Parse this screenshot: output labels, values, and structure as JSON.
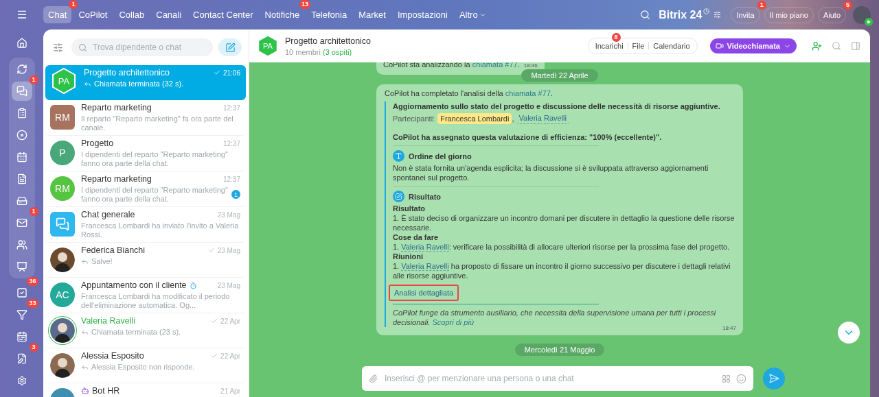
{
  "top_nav": {
    "items": [
      {
        "label": "Chat",
        "selected": true,
        "badge": "1",
        "caret": false
      },
      {
        "label": "CoPilot",
        "selected": false,
        "caret": false
      },
      {
        "label": "Collab",
        "selected": false,
        "caret": false
      },
      {
        "label": "Canali",
        "selected": false,
        "caret": false
      },
      {
        "label": "Contact Center",
        "selected": false,
        "caret": false
      },
      {
        "label": "Notifiche",
        "selected": false,
        "badge": "13",
        "caret": false
      },
      {
        "label": "Telefonia",
        "selected": false,
        "caret": false
      },
      {
        "label": "Market",
        "selected": false,
        "caret": false
      },
      {
        "label": "Impostazioni",
        "selected": false,
        "caret": false
      },
      {
        "label": "Altro",
        "selected": false,
        "caret": true
      }
    ],
    "brand": "Bitrix 24",
    "buttons": [
      {
        "label": "Invita",
        "badge": "1"
      },
      {
        "label": "Il mio piano"
      },
      {
        "label": "Aiuto",
        "badge": "5"
      }
    ]
  },
  "rail": {
    "sections": [
      {
        "framed": false,
        "items": [
          {
            "kind": "home",
            "selected": false
          }
        ]
      },
      {
        "framed": true,
        "items": [
          {
            "kind": "feed",
            "selected": false
          },
          {
            "kind": "chat",
            "selected": true,
            "badge": "1"
          },
          {
            "kind": "list",
            "selected": false
          },
          {
            "kind": "target",
            "selected": false
          },
          {
            "kind": "calendar",
            "selected": false
          },
          {
            "kind": "file",
            "selected": false
          },
          {
            "kind": "drive",
            "selected": false
          },
          {
            "kind": "mail",
            "selected": false,
            "badge": "1"
          },
          {
            "kind": "users",
            "selected": false
          },
          {
            "kind": "board",
            "selected": false
          }
        ]
      },
      {
        "framed": false,
        "items": [
          {
            "kind": "tasks",
            "selected": false,
            "badge": "36"
          },
          {
            "kind": "funnel",
            "selected": false,
            "badge": "33"
          },
          {
            "kind": "schedule",
            "selected": false
          },
          {
            "kind": "sign",
            "selected": false,
            "badge": "3"
          }
        ]
      }
    ]
  },
  "chat_list": {
    "search_placeholder": "Trova dipendente o chat",
    "items": [
      {
        "name": "Progetto architettonico",
        "preview": {
          "kind": "reply",
          "text": "Chiamata terminata (32 s)."
        },
        "time": "21:06",
        "selected": true,
        "read": true,
        "online": false,
        "timer": false,
        "bot": false,
        "avatar": {
          "kind": "hexagon",
          "text": "PA",
          "color": "#2fc249"
        }
      },
      {
        "name": "Reparto marketing",
        "preview": {
          "kind": "plain",
          "text": "Il reparto \"Reparto marketing\" fa ora parte del canale."
        },
        "time": "12:37",
        "selected": false,
        "read": false,
        "online": false,
        "timer": false,
        "bot": false,
        "avatar": {
          "kind": "square",
          "text": "RM",
          "color": "#a7735e"
        }
      },
      {
        "name": "Progetto",
        "preview": {
          "kind": "plain",
          "text": "I dipendenti del reparto \"Reparto marketing\" fanno ora parte della chat."
        },
        "time": "12:37",
        "selected": false,
        "read": false,
        "online": false,
        "timer": false,
        "bot": false,
        "avatar": {
          "kind": "circle",
          "text": "P",
          "color": "#48a87a"
        }
      },
      {
        "name": "Reparto marketing",
        "preview": {
          "kind": "plain",
          "text": "I dipendenti del reparto \"Reparto marketing\" fanno ora parte della chat."
        },
        "time": "12:37",
        "selected": false,
        "read": false,
        "online": false,
        "timer": false,
        "bot": false,
        "unread": "1",
        "avatar": {
          "kind": "circle",
          "text": "RM",
          "color": "#55c440"
        }
      },
      {
        "name": "Chat generale",
        "preview": {
          "kind": "plain",
          "text": "Francesca Lombardi ha inviato l'invito a Valeria Rossi."
        },
        "time": "23 Mag",
        "selected": false,
        "read": false,
        "online": false,
        "timer": false,
        "bot": false,
        "avatar": {
          "kind": "general",
          "color": "#2fb8ee"
        }
      },
      {
        "name": "Federica Bianchi",
        "preview": {
          "kind": "reply",
          "text": "Salve!"
        },
        "time": "23 Mag",
        "selected": false,
        "read": true,
        "online": false,
        "timer": false,
        "bot": false,
        "avatar": {
          "kind": "person",
          "color": "#6b4a2e"
        }
      },
      {
        "name": "Appuntamento con il cliente",
        "preview": {
          "kind": "plain",
          "text": "Francesca Lombardi ha modificato il periodo dell'eliminazione automatica. Og..."
        },
        "time": "23 Mag",
        "selected": false,
        "read": false,
        "online": false,
        "timer": true,
        "bot": false,
        "avatar": {
          "kind": "circle",
          "text": "AC",
          "color": "#22a99a"
        }
      },
      {
        "name": "Valeria Ravelli",
        "preview": {
          "kind": "reply",
          "text": "Chiamata terminata (23 s)."
        },
        "time": "22 Apr",
        "selected": false,
        "read": true,
        "online": true,
        "timer": false,
        "bot": false,
        "avatar": {
          "kind": "person",
          "color": "#5a6a8a"
        }
      },
      {
        "name": "Alessia Esposito",
        "preview": {
          "kind": "reply",
          "text": "Alessia Esposito non risponde."
        },
        "time": "22 Apr",
        "selected": false,
        "read": true,
        "online": false,
        "timer": false,
        "bot": false,
        "avatar": {
          "kind": "person",
          "color": "#8a6a50"
        }
      },
      {
        "name": "Bot HR",
        "time": "21 Apr",
        "selected": false,
        "read": false,
        "online": false,
        "timer": false,
        "bot": true,
        "avatar": {
          "kind": "circle",
          "color": "#3e8fb0"
        }
      }
    ]
  },
  "chat": {
    "title": "Progetto architettonico",
    "avatar": "PA",
    "members": "10 membri",
    "guests": "(3 ospiti)",
    "tabs": [
      {
        "label": "Incarichi",
        "badge": "8"
      },
      {
        "label": "File"
      },
      {
        "label": "Calendario"
      }
    ],
    "call_button": "Videochiamata",
    "messages": [
      {
        "kind": "text",
        "before": "CoPilot sta analizzando la",
        "link": "chiamata #77",
        "after": ".",
        "time": "18:46"
      },
      {
        "kind": "date",
        "text": "Martedì 22 Aprile",
        "overlap": true
      },
      {
        "kind": "report",
        "before": "CoPilot ha completato l'analisi della",
        "link": "chiamata #77",
        "after": ".",
        "title": "Aggiornamento sullo stato del progetto e discussione delle necessità di risorse aggiuntive.",
        "participants_label": "Partecipanti:",
        "participants": [
          {
            "name": "Francesca Lombardi",
            "highlighted": true,
            "separator": ","
          },
          {
            "name": "Valeria Ravelli",
            "highlighted": false
          }
        ],
        "rating": "CoPilot ha assegnato questa valutazione di efficienza: \"100% (eccellente)\".",
        "sections": [
          {
            "kind": "agenda",
            "title": "Ordine del giorno",
            "body": "Non è stata fornita un'agenda esplicita; la discussione si è sviluppata attraverso aggiornamenti spontanei sul progetto."
          },
          {
            "kind": "result",
            "title": "Risultato",
            "groups": [
              {
                "heading": "Risultato",
                "items": [
                  {
                    "number": "1.",
                    "text": "È stato deciso di organizzare un incontro domani per discutere in dettaglio la questione delle risorse necessarie."
                  }
                ]
              },
              {
                "heading": "Cose da fare",
                "items": [
                  {
                    "number": "1.",
                    "mention": "Valeria Ravelli",
                    "text": ": verificare la possibilità di allocare ulteriori risorse per la prossima fase del progetto."
                  }
                ]
              },
              {
                "heading": "Riunioni",
                "items": [
                  {
                    "number": "1.",
                    "mention": "Valeria Ravelli",
                    "text": " ha proposto di fissare un incontro il giorno successivo per discutere i dettagli relativi alle risorse aggiuntive."
                  }
                ]
              }
            ]
          }
        ],
        "detail_link": {
          "label": "Analisi dettagliata",
          "highlighted": true
        },
        "disclaimer": "CoPilot funge da strumento ausiliario, che necessita della supervisione umana per tutti i processi decisionali.",
        "disclaimer_link": "Scopri di più",
        "time": "18:47"
      },
      {
        "kind": "date",
        "text": "Mercoledì 21 Maggio",
        "overlap": false
      },
      {
        "kind": "stub"
      }
    ],
    "input_placeholder": "Inserisci @ per menzionare una persona o una chat"
  }
}
